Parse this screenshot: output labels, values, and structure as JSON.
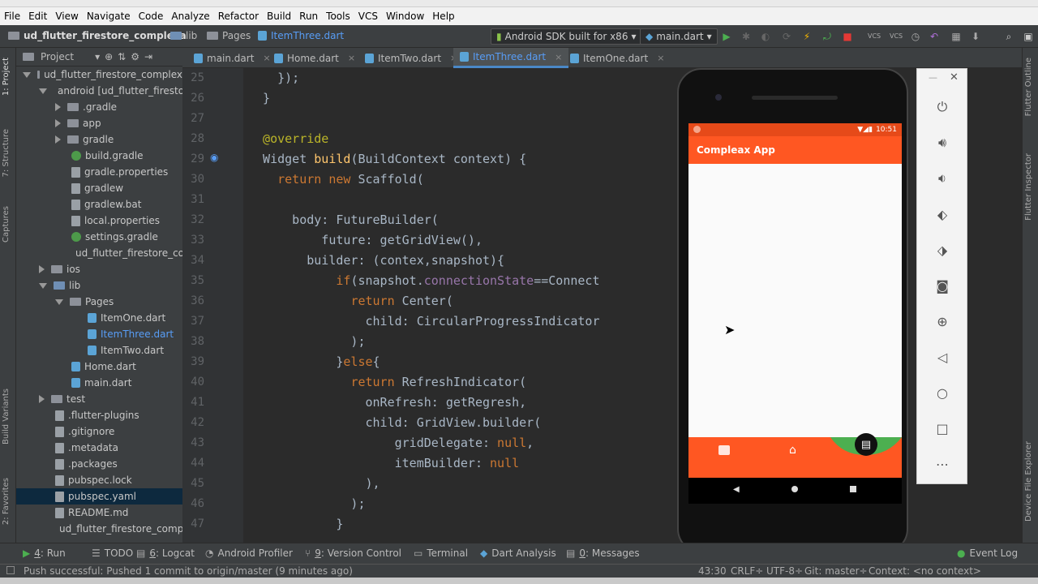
{
  "menu": [
    "File",
    "Edit",
    "View",
    "Navigate",
    "Code",
    "Analyze",
    "Refactor",
    "Build",
    "Run",
    "Tools",
    "VCS",
    "Window",
    "Help"
  ],
  "breadcrumb": {
    "project": "ud_flutter_firestore_complexa",
    "lib": "lib",
    "pages": "Pages",
    "file": "ItemThree.dart"
  },
  "toolbar": {
    "device": "Android SDK built for x86",
    "config": "main.dart"
  },
  "project_panel": {
    "title": "Project"
  },
  "tree": [
    {
      "label": "ud_flutter_firestore_complex",
      "indent": 0,
      "type": "folder",
      "state": "open"
    },
    {
      "label": "android [ud_flutter_firesto",
      "indent": 1,
      "type": "folder",
      "state": "open"
    },
    {
      "label": ".gradle",
      "indent": 2,
      "type": "folder",
      "state": "closed"
    },
    {
      "label": "app",
      "indent": 2,
      "type": "folder",
      "state": "closed"
    },
    {
      "label": "gradle",
      "indent": 2,
      "type": "folder",
      "state": "closed"
    },
    {
      "label": "build.gradle",
      "indent": 3,
      "type": "gradle"
    },
    {
      "label": "gradle.properties",
      "indent": 3,
      "type": "file"
    },
    {
      "label": "gradlew",
      "indent": 3,
      "type": "file"
    },
    {
      "label": "gradlew.bat",
      "indent": 3,
      "type": "file"
    },
    {
      "label": "local.properties",
      "indent": 3,
      "type": "file"
    },
    {
      "label": "settings.gradle",
      "indent": 3,
      "type": "gradle"
    },
    {
      "label": "ud_flutter_firestore_con",
      "indent": 3,
      "type": "file"
    },
    {
      "label": "ios",
      "indent": 1,
      "type": "folder",
      "state": "closed"
    },
    {
      "label": "lib",
      "indent": 1,
      "type": "folderb",
      "state": "open"
    },
    {
      "label": "Pages",
      "indent": 2,
      "type": "folder",
      "state": "open"
    },
    {
      "label": "ItemOne.dart",
      "indent": 4,
      "type": "dart"
    },
    {
      "label": "ItemThree.dart",
      "indent": 4,
      "type": "dart",
      "active": true
    },
    {
      "label": "ItemTwo.dart",
      "indent": 4,
      "type": "dart"
    },
    {
      "label": "Home.dart",
      "indent": 3,
      "type": "dart"
    },
    {
      "label": "main.dart",
      "indent": 3,
      "type": "dart"
    },
    {
      "label": "test",
      "indent": 1,
      "type": "folder",
      "state": "closed"
    },
    {
      "label": ".flutter-plugins",
      "indent": 2,
      "type": "file"
    },
    {
      "label": ".gitignore",
      "indent": 2,
      "type": "file"
    },
    {
      "label": ".metadata",
      "indent": 2,
      "type": "file"
    },
    {
      "label": ".packages",
      "indent": 2,
      "type": "file"
    },
    {
      "label": "pubspec.lock",
      "indent": 2,
      "type": "file"
    },
    {
      "label": "pubspec.yaml",
      "indent": 2,
      "type": "file",
      "selected": true
    },
    {
      "label": "README.md",
      "indent": 2,
      "type": "file"
    },
    {
      "label": "ud_flutter_firestore_comple",
      "indent": 2,
      "type": "file"
    }
  ],
  "tabs": [
    {
      "label": "main.dart"
    },
    {
      "label": "Home.dart"
    },
    {
      "label": "ItemTwo.dart"
    },
    {
      "label": "ItemThree.dart",
      "active": true
    },
    {
      "label": "ItemOne.dart"
    }
  ],
  "line_numbers": [
    "25",
    "26",
    "27",
    "28",
    "29",
    "30",
    "31",
    "32",
    "33",
    "34",
    "35",
    "36",
    "37",
    "38",
    "39",
    "40",
    "41",
    "42",
    "43",
    "44",
    "45",
    "46",
    "47"
  ],
  "code_lines": [
    [
      {
        "t": "    });",
        "c": "d"
      }
    ],
    [
      {
        "t": "  }",
        "c": "d"
      }
    ],
    [
      {
        "t": "",
        "c": "d"
      }
    ],
    [
      {
        "t": "  @override",
        "c": "an"
      }
    ],
    [
      {
        "t": "  Widget ",
        "c": "d"
      },
      {
        "t": "build",
        "c": "fn"
      },
      {
        "t": "(BuildContext context) {",
        "c": "d"
      }
    ],
    [
      {
        "t": "    ",
        "c": "d"
      },
      {
        "t": "return new ",
        "c": "kw"
      },
      {
        "t": "Scaffold(",
        "c": "d"
      }
    ],
    [
      {
        "t": "",
        "c": "d"
      }
    ],
    [
      {
        "t": "      body: FutureBuilder(",
        "c": "d"
      }
    ],
    [
      {
        "t": "          future: getGridView(),",
        "c": "d"
      }
    ],
    [
      {
        "t": "        builder: (contex,snapshot){",
        "c": "d"
      }
    ],
    [
      {
        "t": "            ",
        "c": "d"
      },
      {
        "t": "if",
        "c": "kw"
      },
      {
        "t": "(snapshot.",
        "c": "d"
      },
      {
        "t": "connectionState",
        "c": "pr"
      },
      {
        "t": "==Connect",
        "c": "d"
      }
    ],
    [
      {
        "t": "              ",
        "c": "d"
      },
      {
        "t": "return ",
        "c": "kw"
      },
      {
        "t": "Center(",
        "c": "d"
      }
    ],
    [
      {
        "t": "                child: CircularProgressIndicator",
        "c": "d"
      }
    ],
    [
      {
        "t": "              );",
        "c": "d"
      }
    ],
    [
      {
        "t": "            }",
        "c": "d"
      },
      {
        "t": "else",
        "c": "kw"
      },
      {
        "t": "{",
        "c": "d"
      }
    ],
    [
      {
        "t": "              ",
        "c": "d"
      },
      {
        "t": "return ",
        "c": "kw"
      },
      {
        "t": "RefreshIndicator(",
        "c": "d"
      }
    ],
    [
      {
        "t": "                onRefresh: getRegresh,",
        "c": "d"
      }
    ],
    [
      {
        "t": "                child: GridView.builder(",
        "c": "d"
      }
    ],
    [
      {
        "t": "                    gridDelegate: ",
        "c": "d"
      },
      {
        "t": "null",
        "c": "kw"
      },
      {
        "t": ",",
        "c": "d"
      }
    ],
    [
      {
        "t": "                    itemBuilder: ",
        "c": "d"
      },
      {
        "t": "null",
        "c": "kw"
      }
    ],
    [
      {
        "t": "                ),",
        "c": "d"
      }
    ],
    [
      {
        "t": "              );",
        "c": "d"
      }
    ],
    [
      {
        "t": "            }",
        "c": "d"
      }
    ]
  ],
  "phone": {
    "status_time": "10:51",
    "app_title": "Compleax App"
  },
  "emulator_controls": [
    "power-icon",
    "volume-up-icon",
    "volume-down-icon",
    "rotate-left-icon",
    "rotate-right-icon",
    "camera-icon",
    "zoom-icon",
    "back-icon",
    "home-icon",
    "overview-icon",
    "more-icon"
  ],
  "bottom_tools": [
    {
      "key": "4",
      "label": ": Run"
    },
    {
      "key": "",
      "label": "TODO"
    },
    {
      "key": "6",
      "label": ": Logcat"
    },
    {
      "key": "",
      "label": "Android Profiler"
    },
    {
      "key": "9",
      "label": ": Version Control"
    },
    {
      "key": "",
      "label": "Terminal"
    },
    {
      "key": "",
      "label": "Dart Analysis"
    },
    {
      "key": "0",
      "label": ": Messages"
    }
  ],
  "event_log": "Event Log",
  "status": {
    "message": "Push successful: Pushed 1 commit to origin/master (9 minutes ago)",
    "position": "43:30",
    "line_sep": "CRLF÷",
    "encoding": "UTF-8÷",
    "git": "Git: master÷",
    "context": "Context: <no context>"
  },
  "left_vtabs": [
    "1: Project",
    "7: Structure",
    "Captures",
    "Build Variants",
    "2: Favorites"
  ],
  "right_vtabs": [
    "Flutter Outline",
    "Flutter Inspector",
    "Device File Explorer"
  ],
  "colors": {
    "accent": "#ff5722",
    "statusbar": "#e64a19",
    "editor_bg": "#2b2b2b",
    "panel_bg": "#3c3f41"
  }
}
